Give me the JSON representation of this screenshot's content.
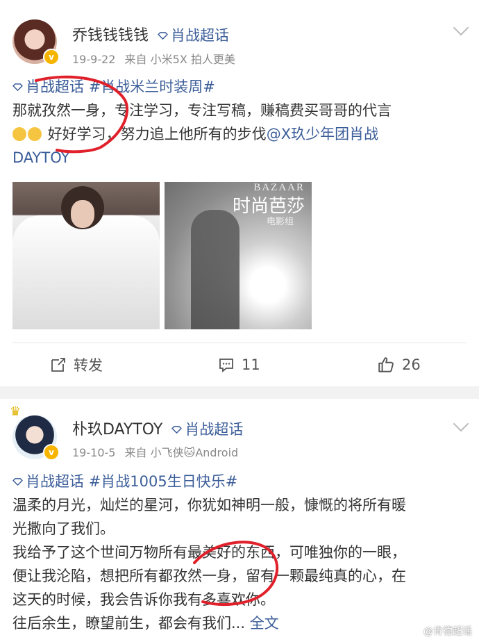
{
  "post1": {
    "username": "乔钱钱钱钱",
    "super_topic": "肖战超话",
    "date": "19-9-22",
    "source": "来自 小米5X 拍人更美",
    "lines": {
      "l1_topic1": "肖战超话",
      "l1_topic2": "#肖战米兰时装周#",
      "l2": "那就孜然一身，专注学习，专注写稿，赚稿费买哥哥的代言",
      "l3_text": "好好学习，努力追上他所有的步伐",
      "l3_mention": "@X玖少年团肖战",
      "l4_mention": "DAYTOY"
    },
    "images": {
      "img2_mag_en": "BAZAAR",
      "img2_mag_cn": "时尚芭莎",
      "img2_mag_sub": "电影组"
    },
    "actions": {
      "repost_label": "转发",
      "comment_count": "11",
      "like_count": "26"
    }
  },
  "post2": {
    "username": "朴玖DAYTOY",
    "super_topic": "肖战超话",
    "date": "19-10-5",
    "source": "来自 小飞侠🐱Android",
    "lines": {
      "l1_topic1": "肖战超话",
      "l1_topic2": "#肖战1005生日快乐#",
      "l2": "温柔的月光，灿烂的星河，你犹如神明一般，慷慨的将所有暖",
      "l3": "光撒向了我们。",
      "l4": "我给予了这个世间万物所有最美好的东西，可唯独你的一眼，",
      "l5": "便让我沦陷，想把所有都孜然一身，留有一颗最纯真的心，在",
      "l6": "这天的时候，我会告诉你我有多喜欢你。",
      "l7_text": "往后余生，瞭望前生，都会有我们...",
      "l7_more": "全文"
    }
  },
  "watermark": "@肯德超话",
  "colors": {
    "link": "#3b5d99",
    "annotation": "#e0202a",
    "badge": "#f7b500"
  }
}
